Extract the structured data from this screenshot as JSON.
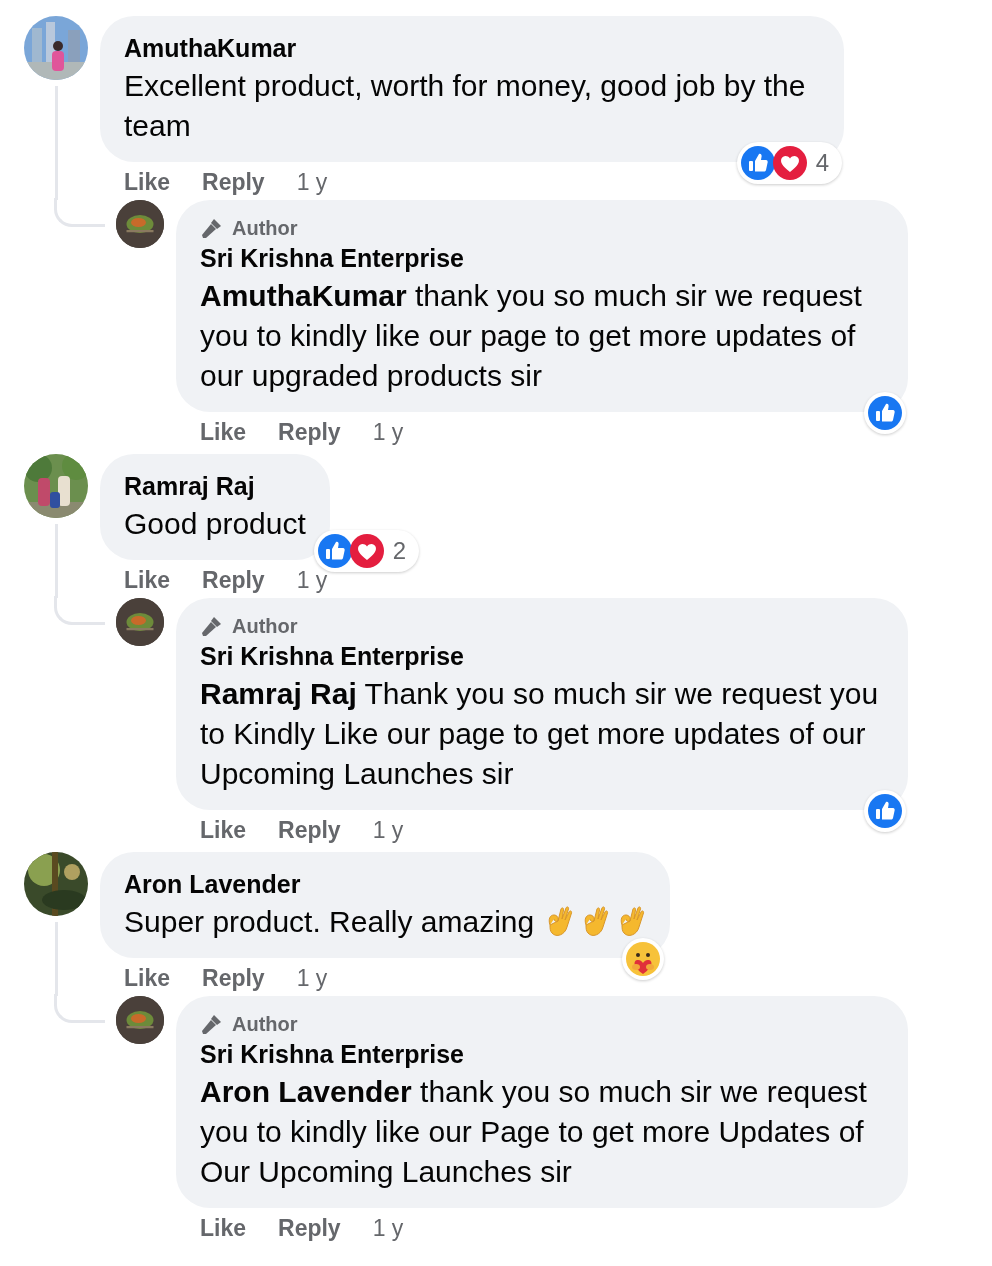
{
  "threads": [
    {
      "comment": {
        "name": "AmuthaKumar",
        "text": "Excellent product, worth for money, good job by the team",
        "reactions": {
          "kinds": [
            {
              "kind": "like"
            },
            {
              "kind": "love"
            }
          ],
          "count": "4"
        },
        "actions": [
          "Like",
          "Reply"
        ],
        "time": "1 y"
      },
      "replies": [
        {
          "badge": "Author",
          "name": "Sri Krishna Enterprise",
          "text": "**AmuthaKumar** thank you so much sir we request you to kindly like our page to get more updates of our upgraded products sir",
          "reactions": {
            "kinds": [
              {
                "kind": "like"
              }
            ]
          },
          "actions": [
            "Like",
            "Reply"
          ],
          "time": "1 y"
        }
      ]
    },
    {
      "comment": {
        "name": "Ramraj Raj",
        "text": "Good product",
        "reactions": {
          "kinds": [
            {
              "kind": "like"
            },
            {
              "kind": "love"
            }
          ],
          "count": "2"
        },
        "actions": [
          "Like",
          "Reply"
        ],
        "time": "1 y"
      },
      "replies": [
        {
          "badge": "Author",
          "name": "Sri Krishna Enterprise",
          "text": "**Ramraj Raj** Thank you so much sir we request you to Kindly Like our page to get more updates of our Upcoming Launches sir",
          "reactions": {
            "kinds": [
              {
                "kind": "like"
              }
            ]
          },
          "actions": [
            "Like",
            "Reply"
          ],
          "time": "1 y"
        }
      ]
    },
    {
      "comment": {
        "name": "Aron Lavender",
        "text": "Super product. Really amazing",
        "emojis": [
          {
            "kind": "ok-hand"
          },
          {
            "kind": "ok-hand"
          },
          {
            "kind": "ok-hand"
          }
        ],
        "reactions": {
          "kinds": [
            {
              "kind": "care"
            }
          ]
        },
        "actions": [
          "Like",
          "Reply"
        ],
        "time": "1 y"
      },
      "replies": [
        {
          "badge": "Author",
          "name": "Sri Krishna Enterprise",
          "text": "**Aron Lavender** thank you so much sir we request you to kindly like our Page to get more Updates of Our Upcoming Launches sir",
          "actions": [
            "Like",
            "Reply"
          ],
          "time": "1 y"
        }
      ]
    }
  ]
}
